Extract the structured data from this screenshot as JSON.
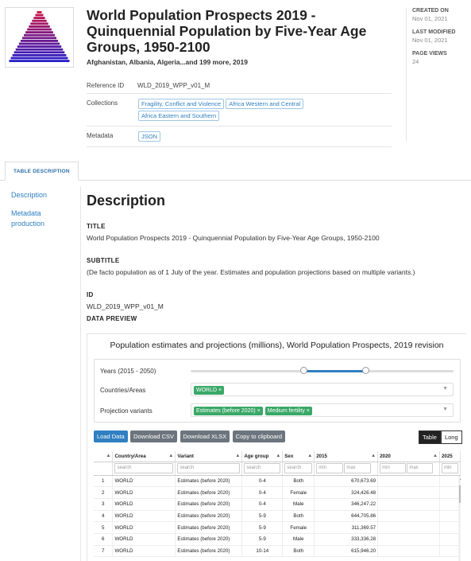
{
  "header": {
    "title": "World Population Prospects 2019 - Quinquennial Population by Five-Year Age Groups, 1950-2100",
    "countries": "Afghanistan, Albania, Algeria...and 199 more, 2019",
    "created_label": "CREATED ON",
    "created_value": "Nov 01, 2021",
    "modified_label": "LAST MODIFIED",
    "modified_value": "Nov 01, 2021",
    "views_label": "PAGE VIEWS",
    "views_value": "24"
  },
  "info": {
    "ref_label": "Reference ID",
    "ref_value": "WLD_2019_WPP_v01_M",
    "collections_label": "Collections",
    "collections": [
      "Fragility, Conflict and Violence",
      "Africa Western and Central",
      "Africa Eastern and Southern"
    ],
    "metadata_label": "Metadata",
    "metadata_chip": "JSON"
  },
  "tabs": {
    "table_description": "TABLE DESCRIPTION"
  },
  "sidenav": {
    "description": "Description",
    "metadata_production": "Metadata production"
  },
  "main": {
    "heading": "Description",
    "title_label": "TITLE",
    "title_value": "World Population Prospects 2019 - Quinquennial Population by Five-Year Age Groups, 1950-2100",
    "subtitle_label": "SUBTITLE",
    "subtitle_value": "(De facto population as of 1 July of the year. Estimates and population projections based on multiple variants.)",
    "id_label": "ID",
    "id_value": "WLD_2019_WPP_v01_M",
    "preview_label": "DATA PREVIEW"
  },
  "preview": {
    "title": "Population estimates and projections (millions), World Population Prospects, 2019 revision",
    "years_label": "Years (2015 - 2050)",
    "countries_label": "Countries/Areas",
    "countries_tag": "WORLD",
    "variants_label": "Projection variants",
    "variant_tags": [
      "Estimates (before 2020)",
      "Medium fertility"
    ],
    "buttons": [
      "Load Data",
      "Download CSV",
      "Download XLSX",
      "Copy to clipboard"
    ],
    "view_table": "Table",
    "view_long": "Long",
    "columns": [
      "Country/Area",
      "Variant",
      "Age group",
      "Sex",
      "2015",
      "2020",
      "2025"
    ],
    "search_placeholder": "search",
    "min_placeholder": "min",
    "max_placeholder": "max",
    "rows": [
      [
        "1",
        "WORLD",
        "Estimates (before 2020)",
        "0-4",
        "Both",
        "670,673.69"
      ],
      [
        "2",
        "WORLD",
        "Estimates (before 2020)",
        "0-4",
        "Female",
        "324,426.48"
      ],
      [
        "3",
        "WORLD",
        "Estimates (before 2020)",
        "0-4",
        "Male",
        "346,247.22"
      ],
      [
        "4",
        "WORLD",
        "Estimates (before 2020)",
        "5-9",
        "Both",
        "644,705.86"
      ],
      [
        "5",
        "WORLD",
        "Estimates (before 2020)",
        "5-9",
        "Female",
        "311,369.57"
      ],
      [
        "6",
        "WORLD",
        "Estimates (before 2020)",
        "5-9",
        "Male",
        "333,336.28"
      ],
      [
        "7",
        "WORLD",
        "Estimates (before 2020)",
        "10-14",
        "Both",
        "615,946.20"
      ]
    ],
    "year_range": [
      2015,
      2050
    ],
    "year_selected": [
      2015,
      2050
    ]
  }
}
